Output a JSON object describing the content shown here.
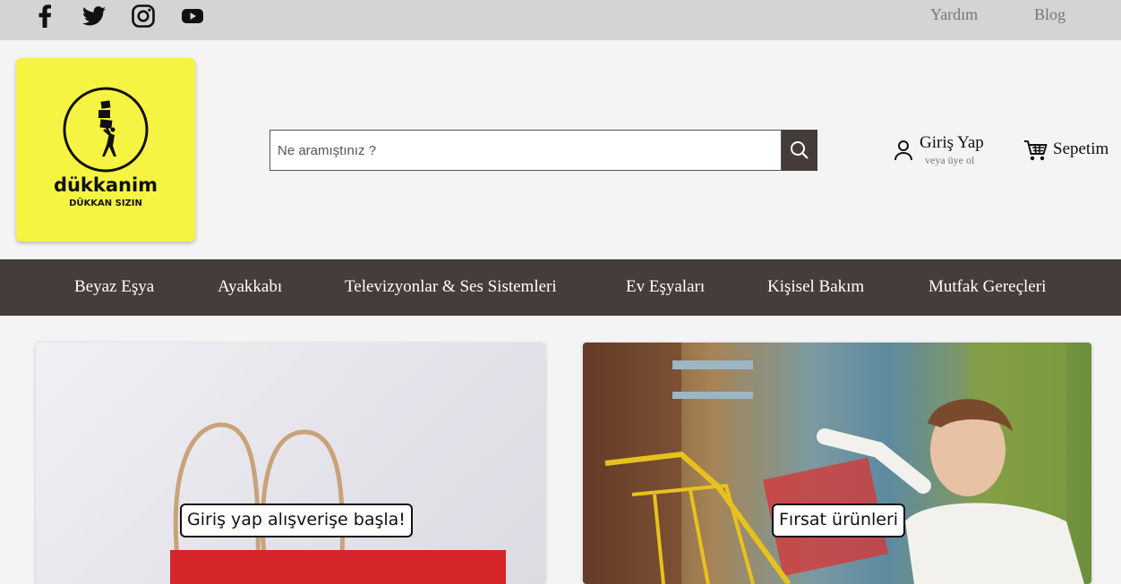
{
  "topbar": {
    "social": [
      "facebook-icon",
      "twitter-icon",
      "instagram-icon",
      "youtube-icon"
    ],
    "links": {
      "help": "Yardım",
      "blog": "Blog"
    }
  },
  "logo": {
    "brand": "dükkanim",
    "tagline": "DÜKKAN SIZIN",
    "bg": "#f6f442"
  },
  "search": {
    "placeholder": "Ne aramıştınız ?",
    "value": ""
  },
  "account": {
    "login": "Giriş Yap",
    "signup": "veya üye ol"
  },
  "cart": {
    "label": "Sepetim"
  },
  "nav": {
    "items": [
      "Beyaz Eşya",
      "Ayakkabı",
      "Televizyonlar & Ses Sistemleri",
      "Ev Eşyaları",
      "Kişisel Bakım",
      "Mutfak Gereçleri"
    ],
    "bg": "#453d3b"
  },
  "banners": [
    {
      "label": "Giriş yap alışverişe başla!"
    },
    {
      "label": "Fırsat ürünleri"
    }
  ]
}
